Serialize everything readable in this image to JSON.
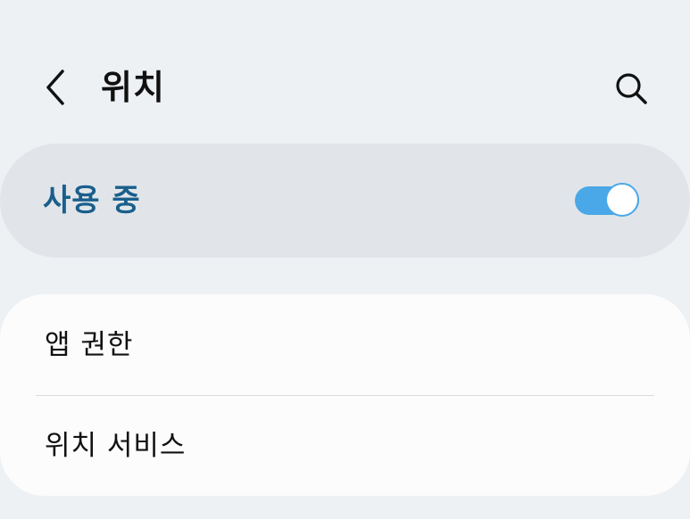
{
  "header": {
    "title": "위치",
    "back_icon": "chevron-left-icon",
    "search_icon": "search-icon"
  },
  "master_switch": {
    "label": "사용 중",
    "state": "on",
    "label_color": "#1a5f8c",
    "accent_color": "#4aa8e8"
  },
  "settings_list": {
    "items": [
      {
        "label": "앱 권한"
      },
      {
        "label": "위치 서비스"
      }
    ]
  }
}
